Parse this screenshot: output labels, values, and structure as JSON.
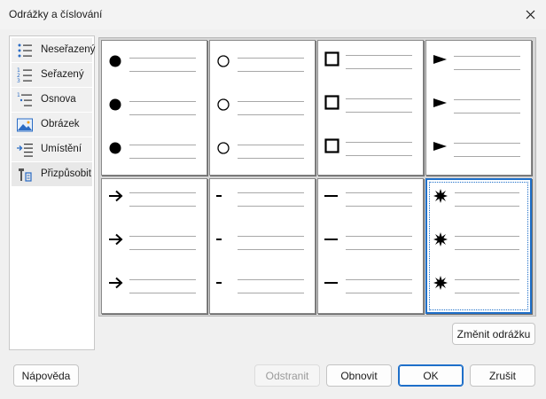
{
  "dialog": {
    "title": "Odrážky a číslování",
    "close_icon": "close-icon"
  },
  "sidebar": {
    "items": [
      {
        "label": "Neseřazený",
        "icon": "bulleted-list-icon"
      },
      {
        "label": "Seřazený",
        "icon": "numbered-list-icon"
      },
      {
        "label": "Osnova",
        "icon": "outline-list-icon"
      },
      {
        "label": "Obrázek",
        "icon": "picture-icon"
      },
      {
        "label": "Umístění",
        "icon": "indent-position-icon"
      },
      {
        "label": "Přizpůsobit",
        "icon": "customize-icon"
      }
    ]
  },
  "bullet_styles": [
    {
      "icon": "filled-circle-bullet-icon"
    },
    {
      "icon": "hollow-circle-bullet-icon"
    },
    {
      "icon": "hollow-square-bullet-icon"
    },
    {
      "icon": "right-triangle-bullet-icon"
    },
    {
      "icon": "right-arrow-bullet-icon"
    },
    {
      "icon": "short-dash-bullet-icon"
    },
    {
      "icon": "long-dash-bullet-icon"
    },
    {
      "icon": "star-burst-bullet-icon",
      "selected": true
    }
  ],
  "buttons": {
    "change_bullet": "Změnit odrážku",
    "help": "Nápověda",
    "remove": "Odstranit",
    "reset": "Obnovit",
    "ok": "OK",
    "cancel": "Zrušit"
  },
  "colors": {
    "accent": "#1e6fc9",
    "disabled_text": "#9a9a9a"
  }
}
